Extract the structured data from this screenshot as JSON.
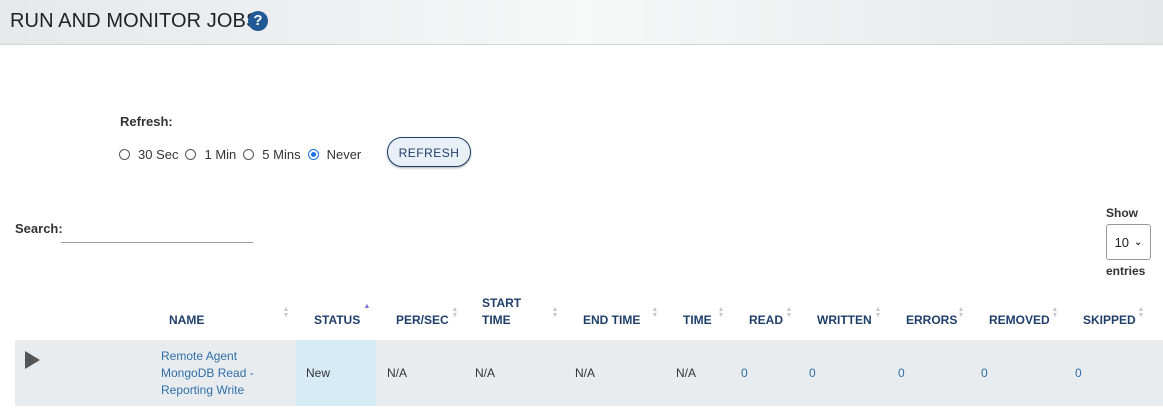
{
  "header": {
    "title": "RUN AND MONITOR JOBS",
    "help_icon": "question-circle-icon"
  },
  "refresh": {
    "label": "Refresh:",
    "options": [
      {
        "label": "30 Sec",
        "checked": false
      },
      {
        "label": "1 Min",
        "checked": false
      },
      {
        "label": "5 Mins",
        "checked": false
      },
      {
        "label": "Never",
        "checked": true
      }
    ],
    "button_label": "REFRESH"
  },
  "search": {
    "label": "Search:",
    "value": ""
  },
  "page_length": {
    "show_label": "Show",
    "selected": "10",
    "entries_label": "entries"
  },
  "table": {
    "columns": {
      "name": "NAME",
      "status": "STATUS",
      "per_sec": "PER/SEC",
      "start_time_1": "START",
      "start_time_2": "TIME",
      "end_time": "END TIME",
      "time": "TIME",
      "read": "READ",
      "written": "WRITTEN",
      "errors": "ERRORS",
      "removed": "REMOVED",
      "skipped": "SKIPPED"
    },
    "sorted_column": "status",
    "rows": [
      {
        "name_lines": [
          "Remote Agent",
          "MongoDB Read -",
          "Reporting Write"
        ],
        "status": "New",
        "per_sec": "N/A",
        "start_time": "N/A",
        "end_time": "N/A",
        "time": "N/A",
        "read": "0",
        "written": "0",
        "errors": "0",
        "removed": "0",
        "skipped": "0"
      }
    ]
  },
  "colors": {
    "accent": "#1f3f6a",
    "link": "#2f6fa8",
    "status_highlight": "#d7ebf6",
    "row_bg": "#e9ecef"
  }
}
